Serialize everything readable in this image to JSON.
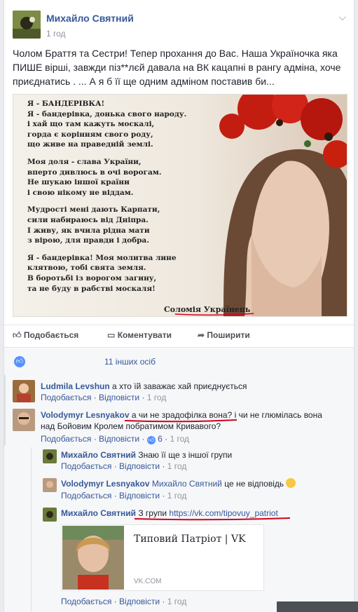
{
  "post": {
    "author": "Михайло Святний",
    "time": "1 год",
    "text": "Чолом Браття та Сестри! Тепер прохання до Вас. Наша Україночка яка ПИШЕ вірші, завжди піз**лєй давала на ВК кацапні в рангу адміна, хоче приєднатись . ... А я б її ще одним адміном поставив би..."
  },
  "image": {
    "stanzas": [
      "Я - БАНДЕРІВКА!\nЯ - бандерівка, донька свого народу.\nі хай що там кажуть москалі,\nгорда є корінням свого роду,\nщо живе на праведній землі.",
      "Моя доля - слава України,\nвперто дивлюсь в очі ворогам.\nНе шукаю іншої країни\nі свою нікому не віддам.",
      "Мудрості мені дають Карпати,\nсили набираюсь від Дніпра.\nІ живу, як вчила рідна мати\nз вірою, для правди і добра.",
      "Я - бандерівка! Моя молитва лине\nклятвою, тобі свята земля.\nВ боротьбі із ворогом загину,\nта не буду в рабстві москаля!"
    ],
    "signature": "Соломія Українець"
  },
  "actions": {
    "like": "Подобається",
    "comment": "Коментувати",
    "share": "Поширити"
  },
  "likes": {
    "text": "11 інших осіб"
  },
  "comments": [
    {
      "name": "Ludmila Levshun",
      "text": "а хто їй заважає хай приєднується",
      "like": "Подобається",
      "reply": "Відповісти",
      "time": "1 год"
    },
    {
      "name": "Volodymyr Lesnyakov",
      "text_a": "а чи не зрадофілка вона?",
      "text_b": "і чи не глюмілась вона",
      "text_c": "над Бойовим Кролем побратимом Кривавого?",
      "like": "Подобається",
      "reply": "Відповісти",
      "reactions": "6",
      "time": "1 год"
    }
  ],
  "replies": [
    {
      "name": "Михайло Святний",
      "text": "Знаю її ще з іншої групи",
      "like": "Подобається",
      "reply": "Відповісти",
      "time": "1 год"
    },
    {
      "name": "Volodymyr Lesnyakov",
      "mention": "Михайло Святний",
      "text": "це не відповідь",
      "like": "Подобається",
      "reply": "Відповісти",
      "time": "1 год"
    },
    {
      "name": "Михайло Святний",
      "text": "З групи",
      "link": "https://vk.com/tipovuy_patriot",
      "like": "Подобається",
      "reply": "Відповісти",
      "time": "1 год"
    }
  ],
  "preview": {
    "title": "Типовий Патріот | VK",
    "domain": "VK.COM"
  },
  "colors": {
    "link": "#365899",
    "annotation": "#d0021b",
    "like": "#5890ff"
  }
}
